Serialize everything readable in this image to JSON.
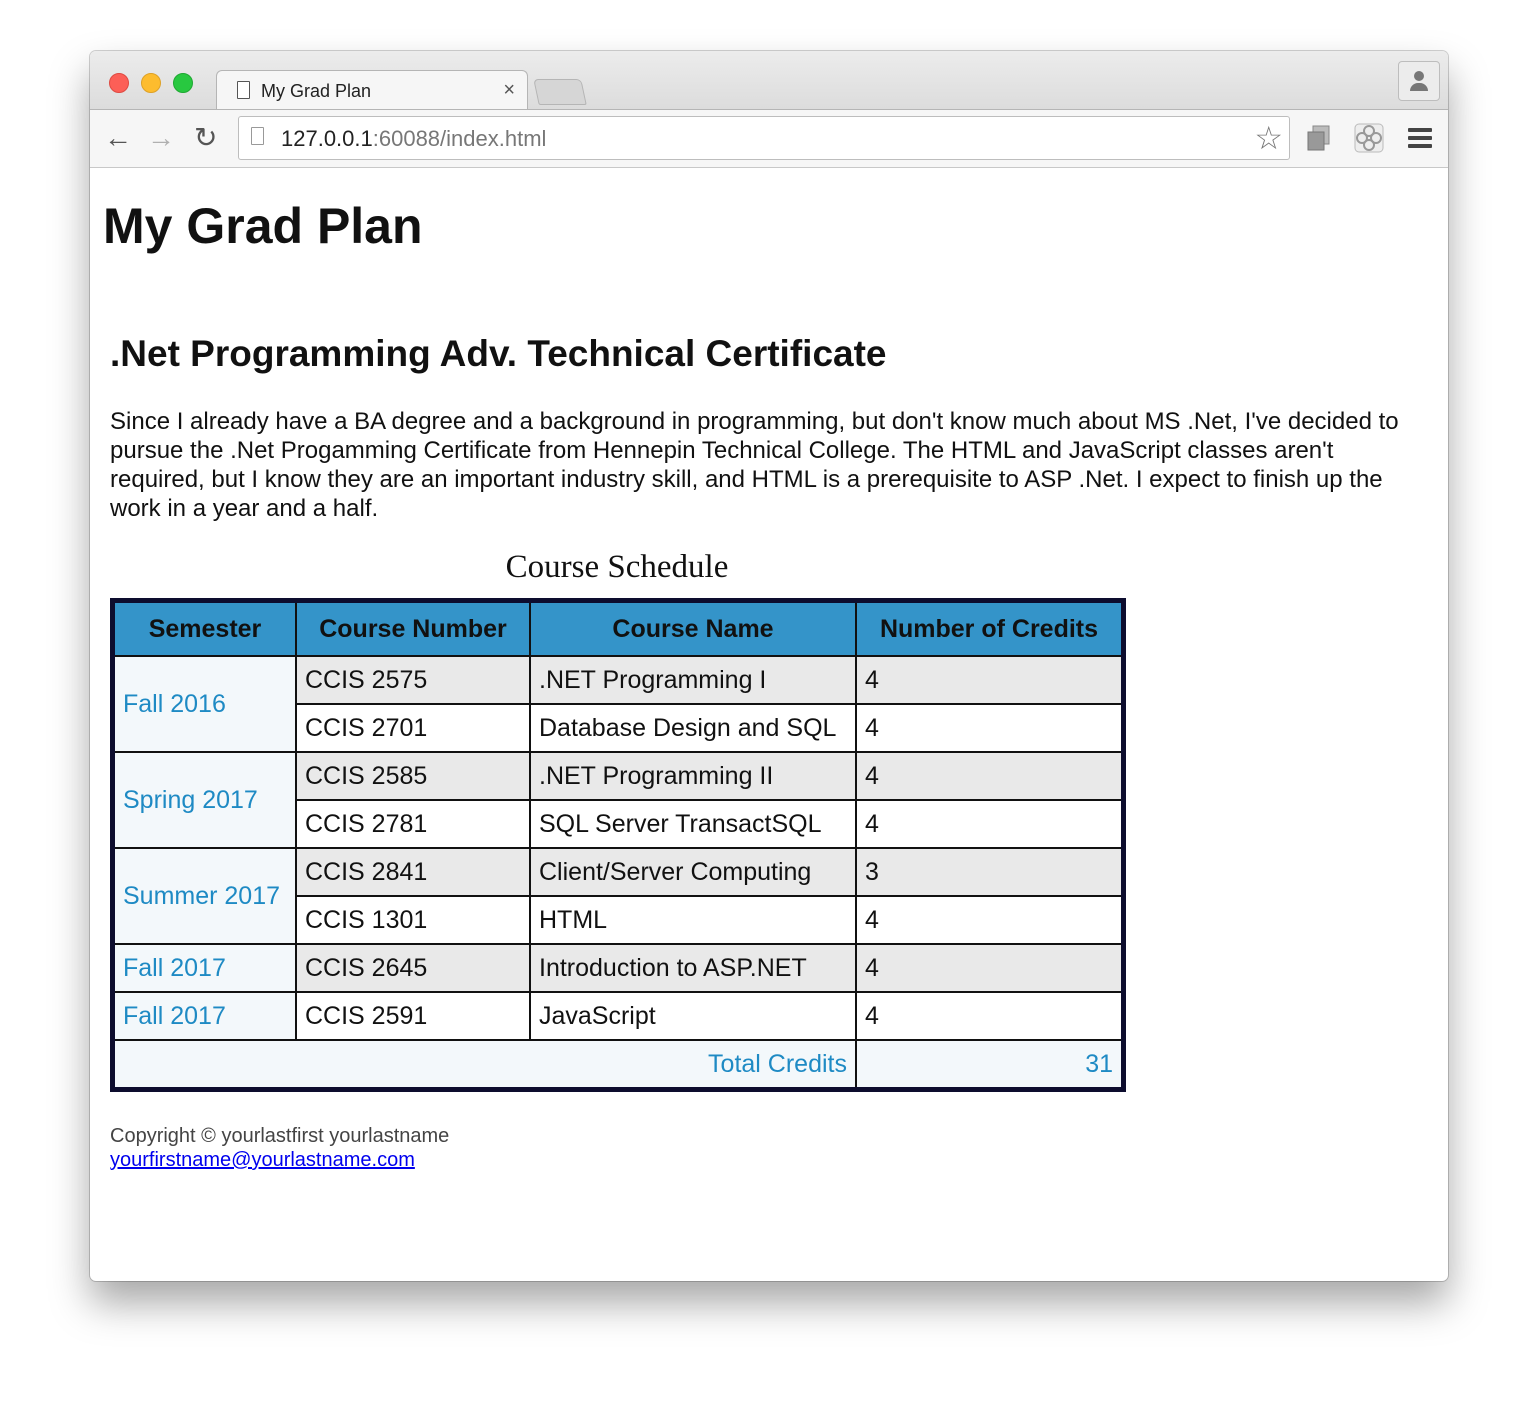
{
  "browser": {
    "tab_title": "My Grad Plan",
    "tab_close": "×",
    "url_host": "127.0.0.1",
    "url_rest": ":60088/index.html",
    "back": "←",
    "forward": "→",
    "reload": "↻",
    "star": "☆"
  },
  "page": {
    "title": "My Grad Plan",
    "section_title": ".Net Programming Adv. Technical Certificate",
    "intro": "Since I already have a BA degree and a background in programming, but don't know much about MS .Net, I've decided to pursue the .Net Progamming Certificate from Hennepin Technical College. The HTML and JavaScript classes aren't required, but I know they are an important industry skill, and HTML is a prerequisite to ASP .Net. I expect to finish up the work in a year and a half."
  },
  "table": {
    "caption": "Course Schedule",
    "headers": [
      "Semester",
      "Course Number",
      "Course Name",
      "Number of Credits"
    ],
    "rows": [
      {
        "semester": "Fall 2016",
        "number": "CCIS 2575",
        "name": ".NET Programming I",
        "credits": "4"
      },
      {
        "number": "CCIS 2701",
        "name": "Database Design and SQL",
        "credits": "4"
      },
      {
        "semester": "Spring 2017",
        "number": "CCIS 2585",
        "name": ".NET Programming II",
        "credits": "4"
      },
      {
        "number": "CCIS 2781",
        "name": "SQL Server TransactSQL",
        "credits": "4"
      },
      {
        "semester": "Summer 2017",
        "number": "CCIS 2841",
        "name": "Client/Server Computing",
        "credits": "3"
      },
      {
        "number": "CCIS 1301",
        "name": "HTML",
        "credits": "4"
      },
      {
        "semester": "Fall 2017",
        "number": "CCIS 2645",
        "name": "Introduction to ASP.NET",
        "credits": "4"
      },
      {
        "semester": "Fall 2017",
        "number": "CCIS 2591",
        "name": "JavaScript",
        "credits": "4"
      }
    ],
    "total_label": "Total Credits",
    "total_value": "31"
  },
  "footer": {
    "copyright": "Copyright © yourlastfirst yourlastname",
    "email": "yourfirstname@yourlastname.com"
  },
  "colors": {
    "header_bg": "#3494c9",
    "semester_text": "#1e8ac4",
    "shaded_row": "#e9e9e9",
    "table_border": "#0d0d2e"
  }
}
